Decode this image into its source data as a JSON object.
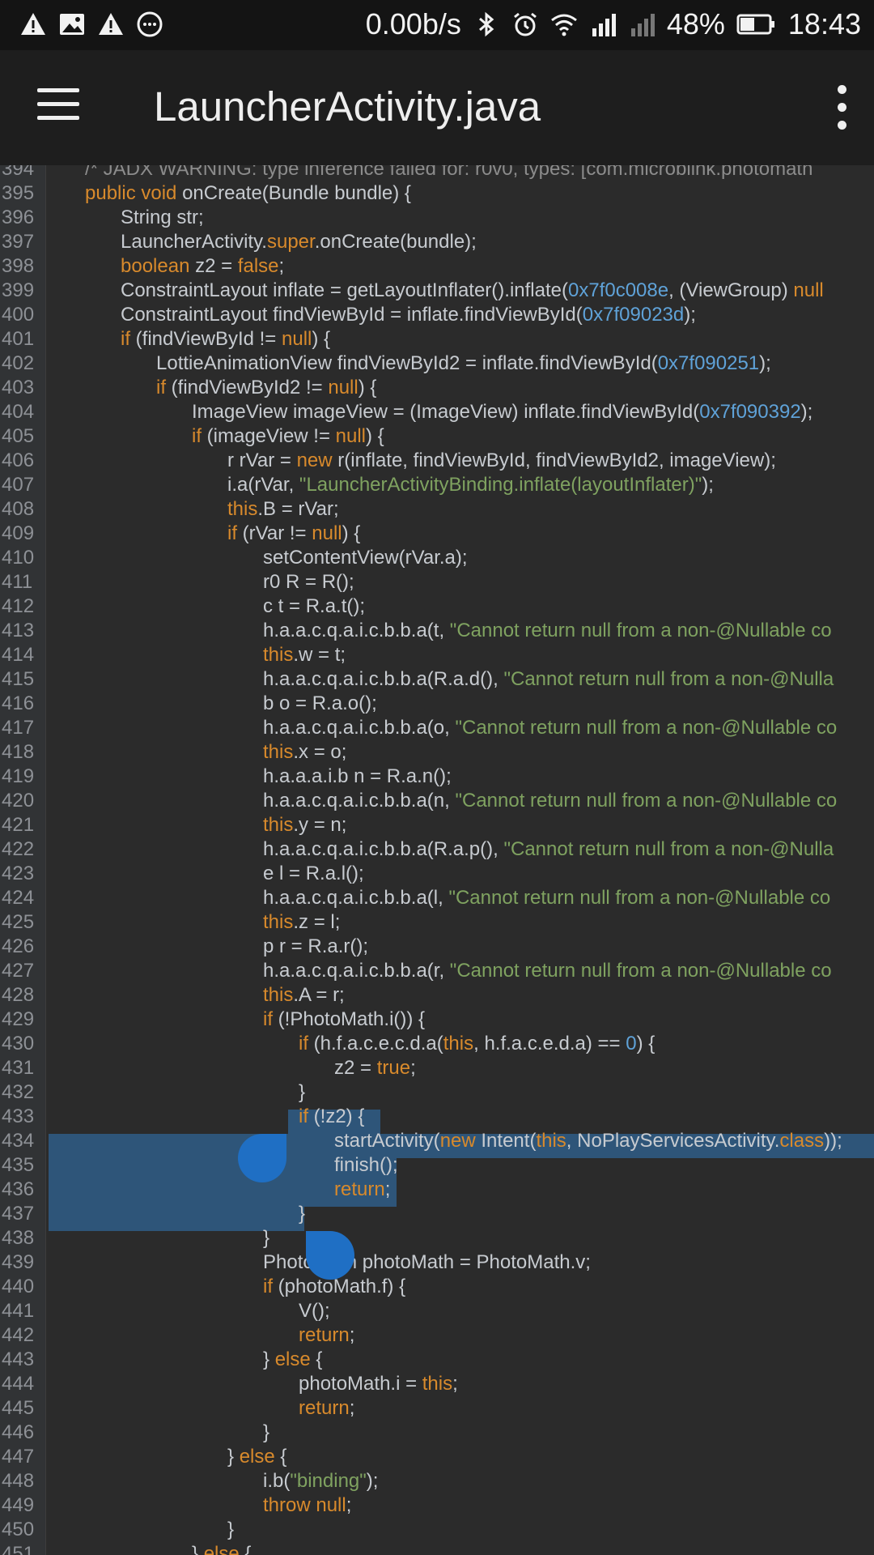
{
  "status_bar": {
    "network_speed": "0.00b/s",
    "battery": "48%",
    "time": "18:43",
    "left_icons": [
      "warning-icon",
      "image-icon",
      "warning-icon",
      "more-circle-icon"
    ],
    "right_icons": [
      "bluetooth-icon",
      "alarm-icon",
      "wifi-icon",
      "signal-icon",
      "signal-weak-icon",
      "battery-icon"
    ]
  },
  "app_bar": {
    "title": "LauncherActivity.java",
    "menu_icon": "hamburger-icon",
    "overflow_icon": "more-vert-icon"
  },
  "editor": {
    "colors": {
      "keyword": "#d88a2c",
      "number": "#5fa2d8",
      "string": "#7fa260",
      "selection": "#2e5579",
      "handle": "#1f6fc4"
    },
    "lines": [
      {
        "n": "394",
        "indent": 1,
        "t": [
          [
            "cm",
            "/* JADX WARNING: type inference failed for: r0v0, types: [com.microblink.photomath"
          ]
        ]
      },
      {
        "n": "395",
        "indent": 1,
        "t": [
          [
            "kw",
            "public void "
          ],
          [
            "",
            "onCreate(Bundle bundle) {"
          ]
        ]
      },
      {
        "n": "396",
        "indent": 2,
        "t": [
          [
            "",
            "String str;"
          ]
        ]
      },
      {
        "n": "397",
        "indent": 2,
        "t": [
          [
            "",
            "LauncherActivity."
          ],
          [
            "kw",
            "super"
          ],
          [
            "",
            ".onCreate(bundle);"
          ]
        ]
      },
      {
        "n": "398",
        "indent": 2,
        "t": [
          [
            "kw",
            "boolean "
          ],
          [
            "",
            "z2 = "
          ],
          [
            "kw",
            "false"
          ],
          [
            "",
            ";"
          ]
        ]
      },
      {
        "n": "399",
        "indent": 2,
        "t": [
          [
            "",
            "ConstraintLayout inflate = getLayoutInflater().inflate("
          ],
          [
            "num",
            "0x7f0c008e"
          ],
          [
            "",
            ", (ViewGroup) "
          ],
          [
            "kw",
            "null"
          ]
        ]
      },
      {
        "n": "400",
        "indent": 2,
        "t": [
          [
            "",
            "ConstraintLayout findViewById = inflate.findViewById("
          ],
          [
            "num",
            "0x7f09023d"
          ],
          [
            "",
            ");"
          ]
        ]
      },
      {
        "n": "401",
        "indent": 2,
        "t": [
          [
            "kw",
            "if "
          ],
          [
            "",
            "(findViewById != "
          ],
          [
            "kw",
            "null"
          ],
          [
            "",
            ") {"
          ]
        ]
      },
      {
        "n": "402",
        "indent": 3,
        "t": [
          [
            "",
            "LottieAnimationView findViewById2 = inflate.findViewById("
          ],
          [
            "num",
            "0x7f090251"
          ],
          [
            "",
            ");"
          ]
        ]
      },
      {
        "n": "403",
        "indent": 3,
        "t": [
          [
            "kw",
            "if "
          ],
          [
            "",
            "(findViewById2 != "
          ],
          [
            "kw",
            "null"
          ],
          [
            "",
            ") {"
          ]
        ]
      },
      {
        "n": "404",
        "indent": 4,
        "t": [
          [
            "",
            "ImageView imageView = (ImageView) inflate.findViewById("
          ],
          [
            "num",
            "0x7f090392"
          ],
          [
            "",
            ");"
          ]
        ]
      },
      {
        "n": "405",
        "indent": 4,
        "t": [
          [
            "kw",
            "if "
          ],
          [
            "",
            "(imageView != "
          ],
          [
            "kw",
            "null"
          ],
          [
            "",
            ") {"
          ]
        ]
      },
      {
        "n": "406",
        "indent": 5,
        "t": [
          [
            "",
            "r rVar = "
          ],
          [
            "kw",
            "new "
          ],
          [
            "",
            "r(inflate, findViewById, findViewById2, imageView);"
          ]
        ]
      },
      {
        "n": "407",
        "indent": 5,
        "t": [
          [
            "",
            "i.a(rVar, "
          ],
          [
            "str",
            "\"LauncherActivityBinding.inflate(layoutInflater)\""
          ],
          [
            "",
            ");"
          ]
        ]
      },
      {
        "n": "408",
        "indent": 5,
        "t": [
          [
            "kw",
            "this"
          ],
          [
            "",
            ".B = rVar;"
          ]
        ]
      },
      {
        "n": "409",
        "indent": 5,
        "t": [
          [
            "kw",
            "if "
          ],
          [
            "",
            "(rVar != "
          ],
          [
            "kw",
            "null"
          ],
          [
            "",
            ") {"
          ]
        ]
      },
      {
        "n": "410",
        "indent": 6,
        "t": [
          [
            "",
            "setContentView(rVar.a);"
          ]
        ]
      },
      {
        "n": "411",
        "indent": 6,
        "t": [
          [
            "",
            "r0 R = R();"
          ]
        ]
      },
      {
        "n": "412",
        "indent": 6,
        "t": [
          [
            "",
            "c t = R.a.t();"
          ]
        ]
      },
      {
        "n": "413",
        "indent": 6,
        "t": [
          [
            "",
            "h.a.a.c.q.a.i.c.b.b.a(t, "
          ],
          [
            "str",
            "\"Cannot return null from a non-@Nullable co"
          ]
        ]
      },
      {
        "n": "414",
        "indent": 6,
        "t": [
          [
            "kw",
            "this"
          ],
          [
            "",
            ".w = t;"
          ]
        ]
      },
      {
        "n": "415",
        "indent": 6,
        "t": [
          [
            "",
            "h.a.a.c.q.a.i.c.b.b.a(R.a.d(), "
          ],
          [
            "str",
            "\"Cannot return null from a non-@Nulla"
          ]
        ]
      },
      {
        "n": "416",
        "indent": 6,
        "t": [
          [
            "",
            "b o = R.a.o();"
          ]
        ]
      },
      {
        "n": "417",
        "indent": 6,
        "t": [
          [
            "",
            "h.a.a.c.q.a.i.c.b.b.a(o, "
          ],
          [
            "str",
            "\"Cannot return null from a non-@Nullable co"
          ]
        ]
      },
      {
        "n": "418",
        "indent": 6,
        "t": [
          [
            "kw",
            "this"
          ],
          [
            "",
            ".x = o;"
          ]
        ]
      },
      {
        "n": "419",
        "indent": 6,
        "t": [
          [
            "",
            "h.a.a.a.i.b n = R.a.n();"
          ]
        ]
      },
      {
        "n": "420",
        "indent": 6,
        "t": [
          [
            "",
            "h.a.a.c.q.a.i.c.b.b.a(n, "
          ],
          [
            "str",
            "\"Cannot return null from a non-@Nullable co"
          ]
        ]
      },
      {
        "n": "421",
        "indent": 6,
        "t": [
          [
            "kw",
            "this"
          ],
          [
            "",
            ".y = n;"
          ]
        ]
      },
      {
        "n": "422",
        "indent": 6,
        "t": [
          [
            "",
            "h.a.a.c.q.a.i.c.b.b.a(R.a.p(), "
          ],
          [
            "str",
            "\"Cannot return null from a non-@Nulla"
          ]
        ]
      },
      {
        "n": "423",
        "indent": 6,
        "t": [
          [
            "",
            "e l = R.a.l();"
          ]
        ]
      },
      {
        "n": "424",
        "indent": 6,
        "t": [
          [
            "",
            "h.a.a.c.q.a.i.c.b.b.a(l, "
          ],
          [
            "str",
            "\"Cannot return null from a non-@Nullable co"
          ]
        ]
      },
      {
        "n": "425",
        "indent": 6,
        "t": [
          [
            "kw",
            "this"
          ],
          [
            "",
            ".z = l;"
          ]
        ]
      },
      {
        "n": "426",
        "indent": 6,
        "t": [
          [
            "",
            "p r = R.a.r();"
          ]
        ]
      },
      {
        "n": "427",
        "indent": 6,
        "t": [
          [
            "",
            "h.a.a.c.q.a.i.c.b.b.a(r, "
          ],
          [
            "str",
            "\"Cannot return null from a non-@Nullable co"
          ]
        ]
      },
      {
        "n": "428",
        "indent": 6,
        "t": [
          [
            "kw",
            "this"
          ],
          [
            "",
            ".A = r;"
          ]
        ]
      },
      {
        "n": "429",
        "indent": 6,
        "t": [
          [
            "kw",
            "if "
          ],
          [
            "",
            "(!PhotoMath.i()) {"
          ]
        ]
      },
      {
        "n": "430",
        "indent": 7,
        "t": [
          [
            "kw",
            "if "
          ],
          [
            "",
            "(h.f.a.c.e.c.d.a("
          ],
          [
            "kw",
            "this"
          ],
          [
            "",
            ", h.f.a.c.e.d.a) == "
          ],
          [
            "num",
            "0"
          ],
          [
            "",
            ") {"
          ]
        ]
      },
      {
        "n": "431",
        "indent": 8,
        "t": [
          [
            "",
            "z2 = "
          ],
          [
            "kw",
            "true"
          ],
          [
            "",
            ";"
          ]
        ]
      },
      {
        "n": "432",
        "indent": 7,
        "t": [
          [
            "",
            "}"
          ]
        ]
      },
      {
        "n": "433",
        "indent": 7,
        "t": [
          [
            "kw",
            "if "
          ],
          [
            "",
            "(!z2) {"
          ]
        ]
      },
      {
        "n": "434",
        "indent": 8,
        "t": [
          [
            "",
            "startActivity("
          ],
          [
            "kw",
            "new "
          ],
          [
            "",
            "Intent("
          ],
          [
            "kw",
            "this"
          ],
          [
            "",
            ", NoPlayServicesActivity."
          ],
          [
            "kw",
            "class"
          ],
          [
            "",
            "));"
          ]
        ]
      },
      {
        "n": "435",
        "indent": 8,
        "t": [
          [
            "",
            "finish();"
          ]
        ]
      },
      {
        "n": "436",
        "indent": 8,
        "t": [
          [
            "kw",
            "return"
          ],
          [
            "",
            ";"
          ]
        ]
      },
      {
        "n": "437",
        "indent": 7,
        "t": [
          [
            "",
            "}"
          ]
        ]
      },
      {
        "n": "438",
        "indent": 6,
        "t": [
          [
            "",
            "}"
          ]
        ]
      },
      {
        "n": "439",
        "indent": 6,
        "t": [
          [
            "",
            "PhotoMath photoMath = PhotoMath.v;"
          ]
        ]
      },
      {
        "n": "440",
        "indent": 6,
        "t": [
          [
            "kw",
            "if "
          ],
          [
            "",
            "(photoMath.f) {"
          ]
        ]
      },
      {
        "n": "441",
        "indent": 7,
        "t": [
          [
            "",
            "V();"
          ]
        ]
      },
      {
        "n": "442",
        "indent": 7,
        "t": [
          [
            "kw",
            "return"
          ],
          [
            "",
            ";"
          ]
        ]
      },
      {
        "n": "443",
        "indent": 6,
        "t": [
          [
            "",
            "} "
          ],
          [
            "kw",
            "else "
          ],
          [
            "",
            "{"
          ]
        ]
      },
      {
        "n": "444",
        "indent": 7,
        "t": [
          [
            "",
            "photoMath.i = "
          ],
          [
            "kw",
            "this"
          ],
          [
            "",
            ";"
          ]
        ]
      },
      {
        "n": "445",
        "indent": 7,
        "t": [
          [
            "kw",
            "return"
          ],
          [
            "",
            ";"
          ]
        ]
      },
      {
        "n": "446",
        "indent": 6,
        "t": [
          [
            "",
            "}"
          ]
        ]
      },
      {
        "n": "447",
        "indent": 5,
        "t": [
          [
            "",
            "} "
          ],
          [
            "kw",
            "else "
          ],
          [
            "",
            "{"
          ]
        ]
      },
      {
        "n": "448",
        "indent": 6,
        "t": [
          [
            "",
            "i.b("
          ],
          [
            "str",
            "\"binding\""
          ],
          [
            "",
            ");"
          ]
        ]
      },
      {
        "n": "449",
        "indent": 6,
        "t": [
          [
            "kw",
            "throw null"
          ],
          [
            "",
            ";"
          ]
        ]
      },
      {
        "n": "450",
        "indent": 5,
        "t": [
          [
            "",
            "}"
          ]
        ]
      },
      {
        "n": "451",
        "indent": 4,
        "t": [
          [
            "",
            "} "
          ],
          [
            "kw",
            "else "
          ],
          [
            "",
            "{"
          ]
        ]
      }
    ]
  }
}
